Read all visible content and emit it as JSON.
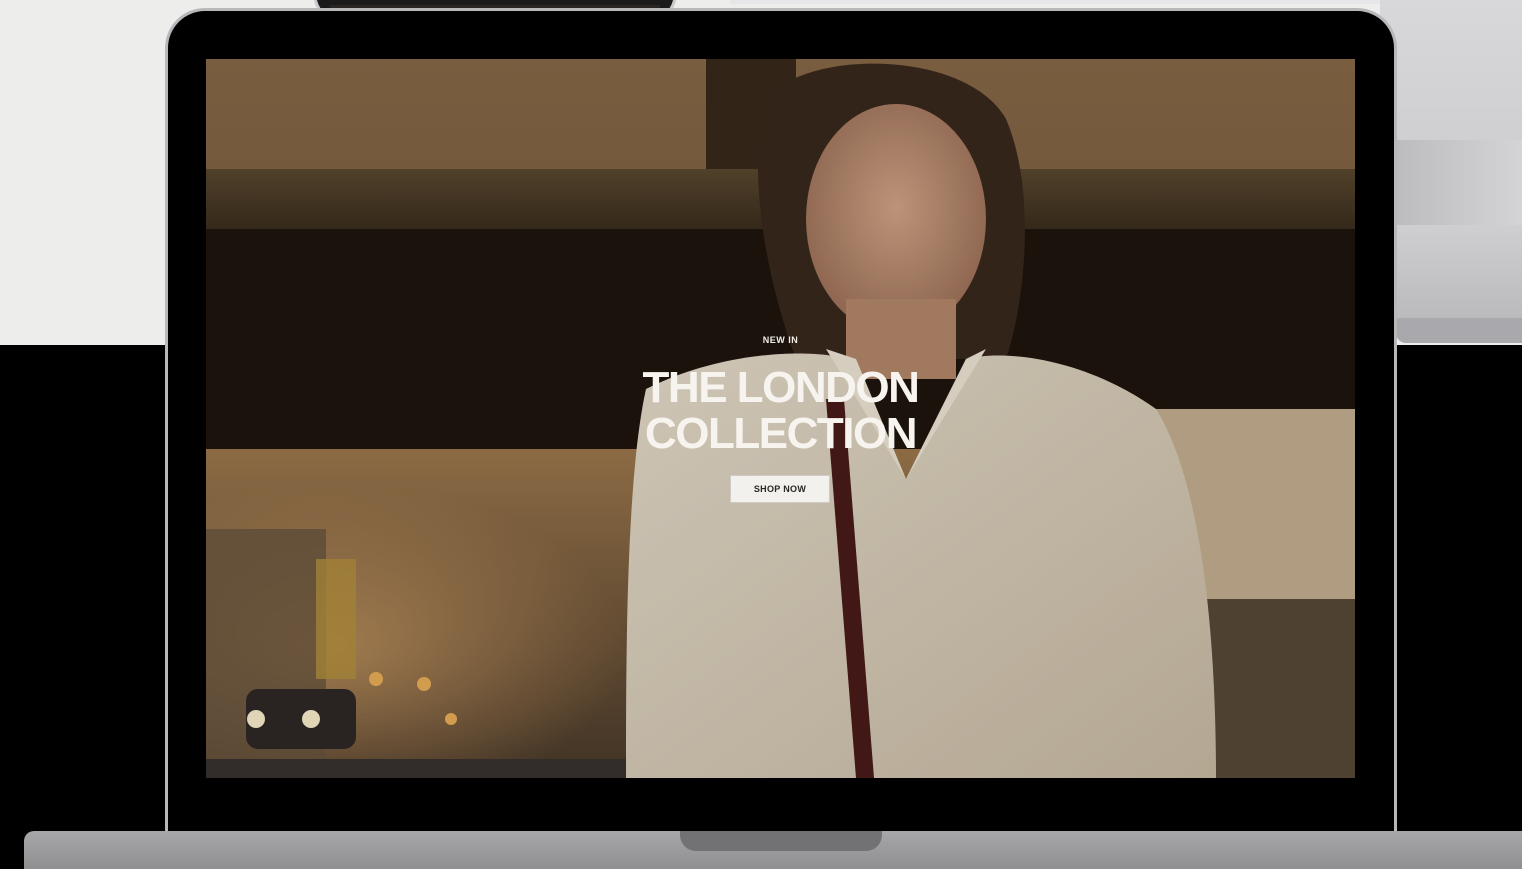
{
  "hero": {
    "eyebrow": "NEW IN",
    "headline_line1": "THE LONDON",
    "headline_line2": "COLLECTION",
    "cta_label": "SHOP NOW"
  },
  "colors": {
    "page_top": "#ededeb",
    "page_bottom": "#000000",
    "headline_text": "#f7f4ef",
    "cta_background": "#f3f1ed",
    "cta_text": "#2a2620"
  },
  "imagery": {
    "hero_photo": "woman-in-white-shirt-street-scene",
    "device_mockup": "laptop"
  }
}
